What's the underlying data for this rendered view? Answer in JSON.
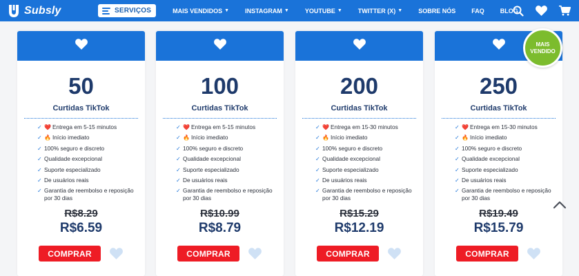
{
  "brand": {
    "name": "Subsly"
  },
  "nav": {
    "services_label": "SERVIÇOS",
    "menu": [
      {
        "label": "MAIS VENDIDOS",
        "caret": true
      },
      {
        "label": "INSTAGRAM",
        "caret": true
      },
      {
        "label": "YOUTUBE",
        "caret": true
      },
      {
        "label": "TWITTER (X)",
        "caret": true
      },
      {
        "label": "SOBRE NÓS",
        "caret": false
      },
      {
        "label": "FAQ",
        "caret": false
      },
      {
        "label": "BLOG",
        "caret": false
      }
    ],
    "caret_glyph": "▼"
  },
  "badge": {
    "line1": "MAIS",
    "line2": "VENDIDO"
  },
  "colors": {
    "primary": "#1a73d9",
    "buy": "#ee1c25",
    "badge": "#7cbc2d",
    "heading": "#1e3a6b"
  },
  "cards": [
    {
      "quantity": "50",
      "label": "Curtidas TikTok",
      "features": [
        {
          "emoji": "❤️",
          "text": "Entrega em 5-15 minutos"
        },
        {
          "emoji": "🔥",
          "text": "Início imediato"
        },
        {
          "emoji": "",
          "text": "100% seguro e discreto"
        },
        {
          "emoji": "",
          "text": "Qualidade excepcional"
        },
        {
          "emoji": "",
          "text": "Suporte especializado"
        },
        {
          "emoji": "",
          "text": "De usuários reais"
        },
        {
          "emoji": "",
          "text": "Garantia de reembolso e reposição por 30 dias"
        }
      ],
      "old_price": "R$8.29",
      "new_price": "R$6.59",
      "buy_label": "COMPRAR"
    },
    {
      "quantity": "100",
      "label": "Curtidas TikTok",
      "features": [
        {
          "emoji": "❤️",
          "text": "Entrega em 5-15 minutos"
        },
        {
          "emoji": "🔥",
          "text": "Início imediato"
        },
        {
          "emoji": "",
          "text": "100% seguro e discreto"
        },
        {
          "emoji": "",
          "text": "Qualidade excepcional"
        },
        {
          "emoji": "",
          "text": "Suporte especializado"
        },
        {
          "emoji": "",
          "text": "De usuários reais"
        },
        {
          "emoji": "",
          "text": "Garantia de reembolso e reposição por 30 dias"
        }
      ],
      "old_price": "R$10.99",
      "new_price": "R$8.79",
      "buy_label": "COMPRAR"
    },
    {
      "quantity": "200",
      "label": "Curtidas TikTok",
      "features": [
        {
          "emoji": "❤️",
          "text": "Entrega em 15-30 minutos"
        },
        {
          "emoji": "🔥",
          "text": "Início imediato"
        },
        {
          "emoji": "",
          "text": "100% seguro e discreto"
        },
        {
          "emoji": "",
          "text": "Qualidade excepcional"
        },
        {
          "emoji": "",
          "text": "Suporte especializado"
        },
        {
          "emoji": "",
          "text": "De usuários reais"
        },
        {
          "emoji": "",
          "text": "Garantia de reembolso e reposição por 30 dias"
        }
      ],
      "old_price": "R$15.29",
      "new_price": "R$12.19",
      "buy_label": "COMPRAR"
    },
    {
      "quantity": "250",
      "label": "Curtidas TikTok",
      "features": [
        {
          "emoji": "❤️",
          "text": "Entrega em 15-30 minutos"
        },
        {
          "emoji": "🔥",
          "text": "Início imediato"
        },
        {
          "emoji": "",
          "text": "100% seguro e discreto"
        },
        {
          "emoji": "",
          "text": "Qualidade excepcional"
        },
        {
          "emoji": "",
          "text": "Suporte especializado"
        },
        {
          "emoji": "",
          "text": "De usuários reais"
        },
        {
          "emoji": "",
          "text": "Garantia de reembolso e reposição por 30 dias"
        }
      ],
      "old_price": "R$19.49",
      "new_price": "R$15.79",
      "buy_label": "COMPRAR"
    }
  ]
}
